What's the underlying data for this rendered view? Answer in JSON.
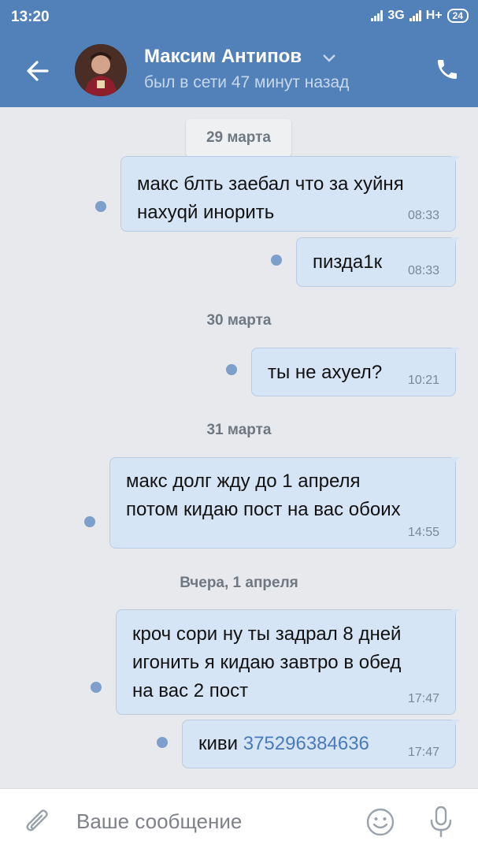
{
  "status_bar": {
    "time": "13:20",
    "network": "3G",
    "network2": "H+",
    "battery": "24"
  },
  "header": {
    "name": "Максим Антипов",
    "status": "был в сети 47 минут назад"
  },
  "messages": {
    "date1": "29 марта",
    "m1": {
      "line1": "макс блть заебал что за хуйня",
      "line2": "нахуqй инорить",
      "time": "08:33"
    },
    "m2": {
      "text": "пизда1к",
      "time": "08:33"
    },
    "date2": "30 марта",
    "m3": {
      "text": "ты не ахуел?",
      "time": "10:21"
    },
    "date3": "31 марта",
    "m4": {
      "line1": "макс долг жду до 1 апреля",
      "line2": "потом кидаю пост на вас обоих",
      "time": "14:55"
    },
    "date4": "Вчера, 1 апреля",
    "m5": {
      "line1": "кроч сори ну ты задрал 8 дней",
      "line2": "игонить я кидаю завтро в обед",
      "line3": "на вас 2 пост",
      "time": "17:47"
    },
    "m6": {
      "prefix": "киви",
      "link": "375296384636",
      "time": "17:47"
    }
  },
  "input": {
    "placeholder": "Ваше сообщение"
  }
}
